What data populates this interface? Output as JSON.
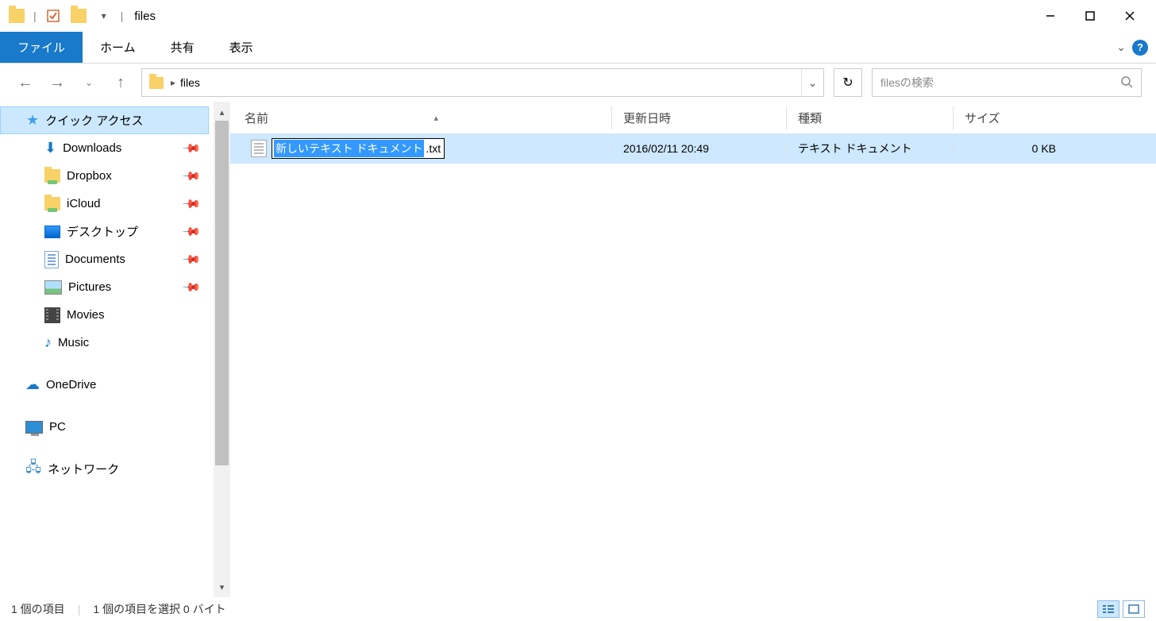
{
  "window": {
    "title": "files"
  },
  "ribbon": {
    "file": "ファイル",
    "tabs": [
      "ホーム",
      "共有",
      "表示"
    ]
  },
  "address": {
    "segments": [
      "files"
    ],
    "search_placeholder": "filesの検索"
  },
  "sidebar": {
    "quick_access": "クイック アクセス",
    "items": [
      {
        "label": "Downloads",
        "pinned": true
      },
      {
        "label": "Dropbox",
        "pinned": true
      },
      {
        "label": "iCloud",
        "pinned": true
      },
      {
        "label": "デスクトップ",
        "pinned": true
      },
      {
        "label": "Documents",
        "pinned": true
      },
      {
        "label": "Pictures",
        "pinned": true
      },
      {
        "label": "Movies",
        "pinned": false
      },
      {
        "label": "Music",
        "pinned": false
      }
    ],
    "onedrive": "OneDrive",
    "pc": "PC",
    "network": "ネットワーク"
  },
  "columns": {
    "name": "名前",
    "date": "更新日時",
    "type": "種類",
    "size": "サイズ"
  },
  "files": [
    {
      "name_editing": "新しいテキスト ドキュメント",
      "ext": ".txt",
      "date": "2016/02/11 20:49",
      "type": "テキスト ドキュメント",
      "size": "0 KB",
      "selected": true,
      "renaming": true
    }
  ],
  "status": {
    "count": "1 個の項目",
    "selected": "1 個の項目を選択 0 バイト"
  }
}
